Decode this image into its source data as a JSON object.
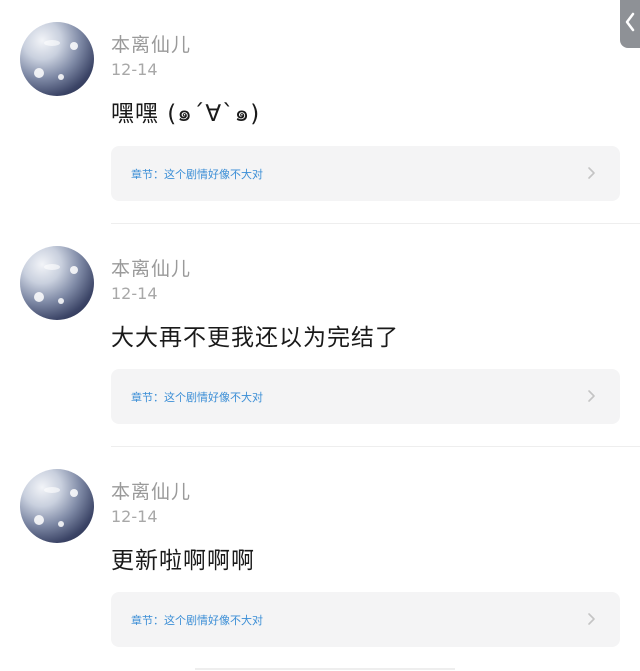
{
  "back_tab": {
    "icon": "chevron-left-icon",
    "glyph": "❮"
  },
  "comments": [
    {
      "username": "本离仙儿",
      "date": "12-14",
      "text": "嘿嘿 (๑´∀`๑)",
      "chapter": "章节：这个剧情好像不大对",
      "chevron_icon": "chevron-right-icon"
    },
    {
      "username": "本离仙儿",
      "date": "12-14",
      "text": "大大再不更我还以为完结了",
      "chapter": "章节：这个剧情好像不大对",
      "chevron_icon": "chevron-right-icon"
    },
    {
      "username": "本离仙儿",
      "date": "12-14",
      "text": "更新啦啊啊啊",
      "chapter": "章节：这个剧情好像不大对",
      "chevron_icon": "chevron-right-icon"
    }
  ],
  "colors": {
    "username": "#9a9a9a",
    "date": "#a8a8a8",
    "text": "#1a1a1a",
    "chapter_link": "#3b8ed6",
    "card_bg": "#f4f4f5"
  }
}
